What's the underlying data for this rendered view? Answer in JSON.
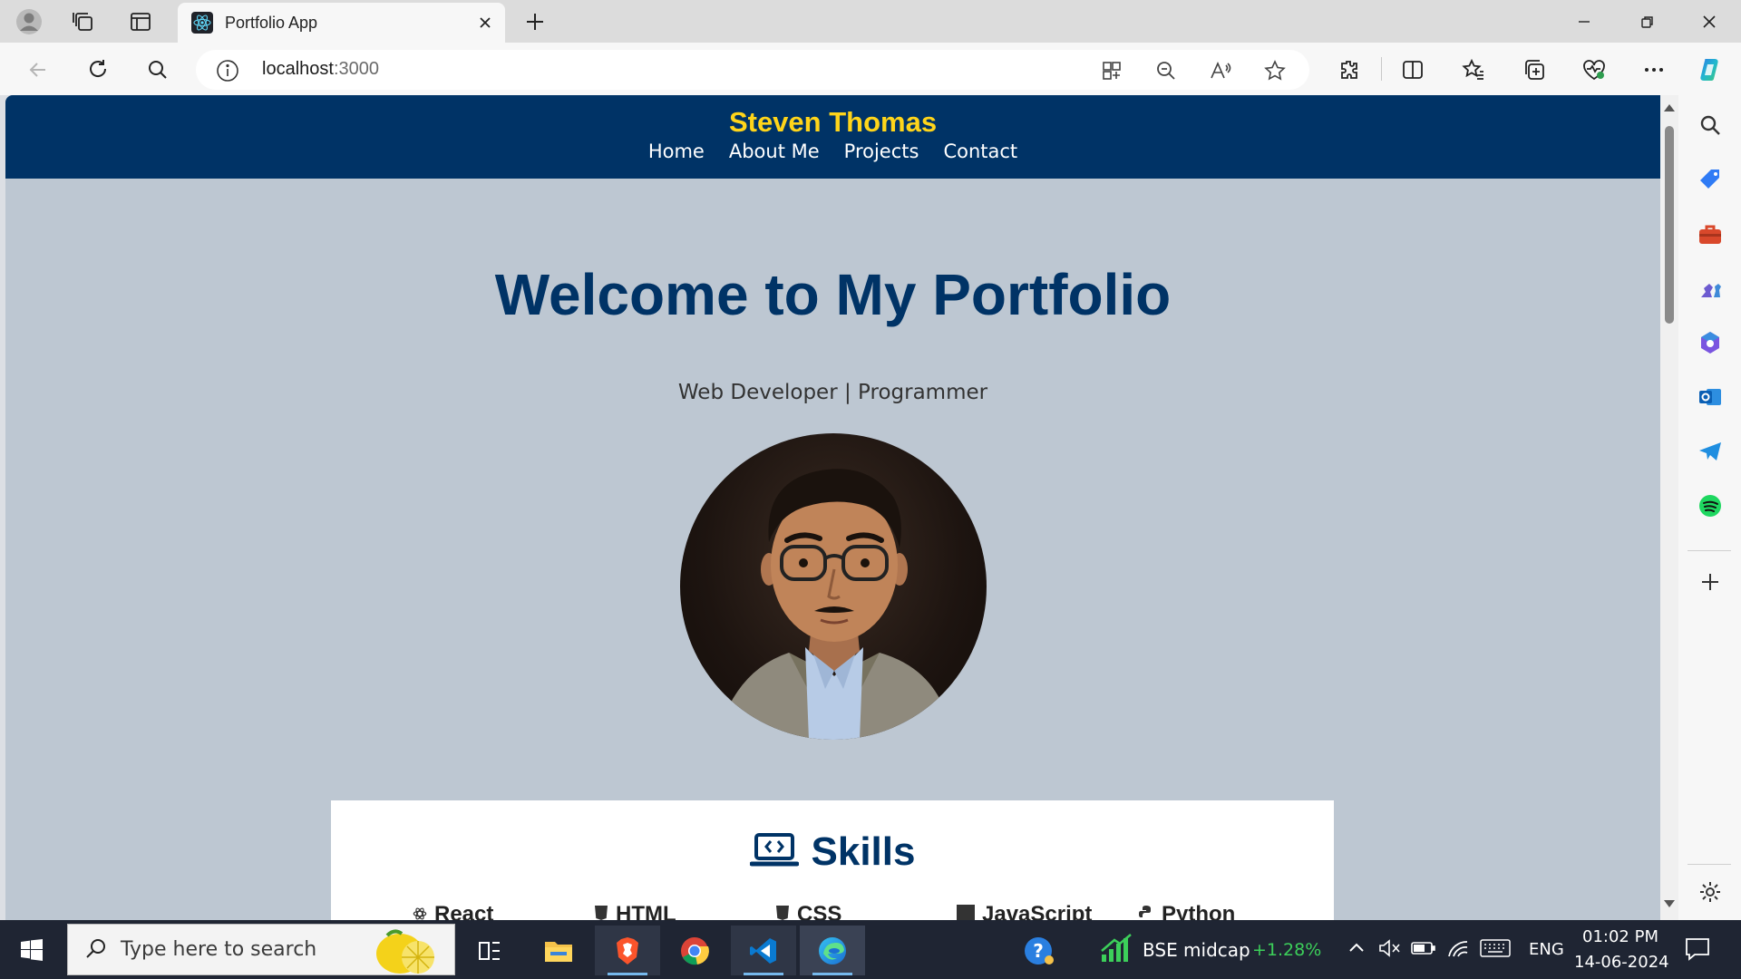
{
  "browser": {
    "tab_title": "Portfolio App",
    "url_host": "localhost",
    "url_port": ":3000"
  },
  "site": {
    "name": "Steven Thomas",
    "nav": [
      "Home",
      "About Me",
      "Projects",
      "Contact"
    ],
    "hero_title": "Welcome to My Portfolio",
    "hero_subtitle": "Web Developer | Programmer",
    "skills_title": "Skills",
    "skills": [
      "React",
      "HTML",
      "CSS",
      "JavaScript",
      "Python"
    ]
  },
  "taskbar": {
    "search_placeholder": "Type here to search",
    "stock_name": "BSE midcap",
    "stock_change": "+1.28%",
    "language": "ENG",
    "time": "01:02 PM",
    "date": "14-06-2024"
  },
  "colors": {
    "site_header": "#003366",
    "site_name": "#ffd51a",
    "page_bg": "#bdc7d2",
    "stock_up": "#3ccf5a"
  }
}
